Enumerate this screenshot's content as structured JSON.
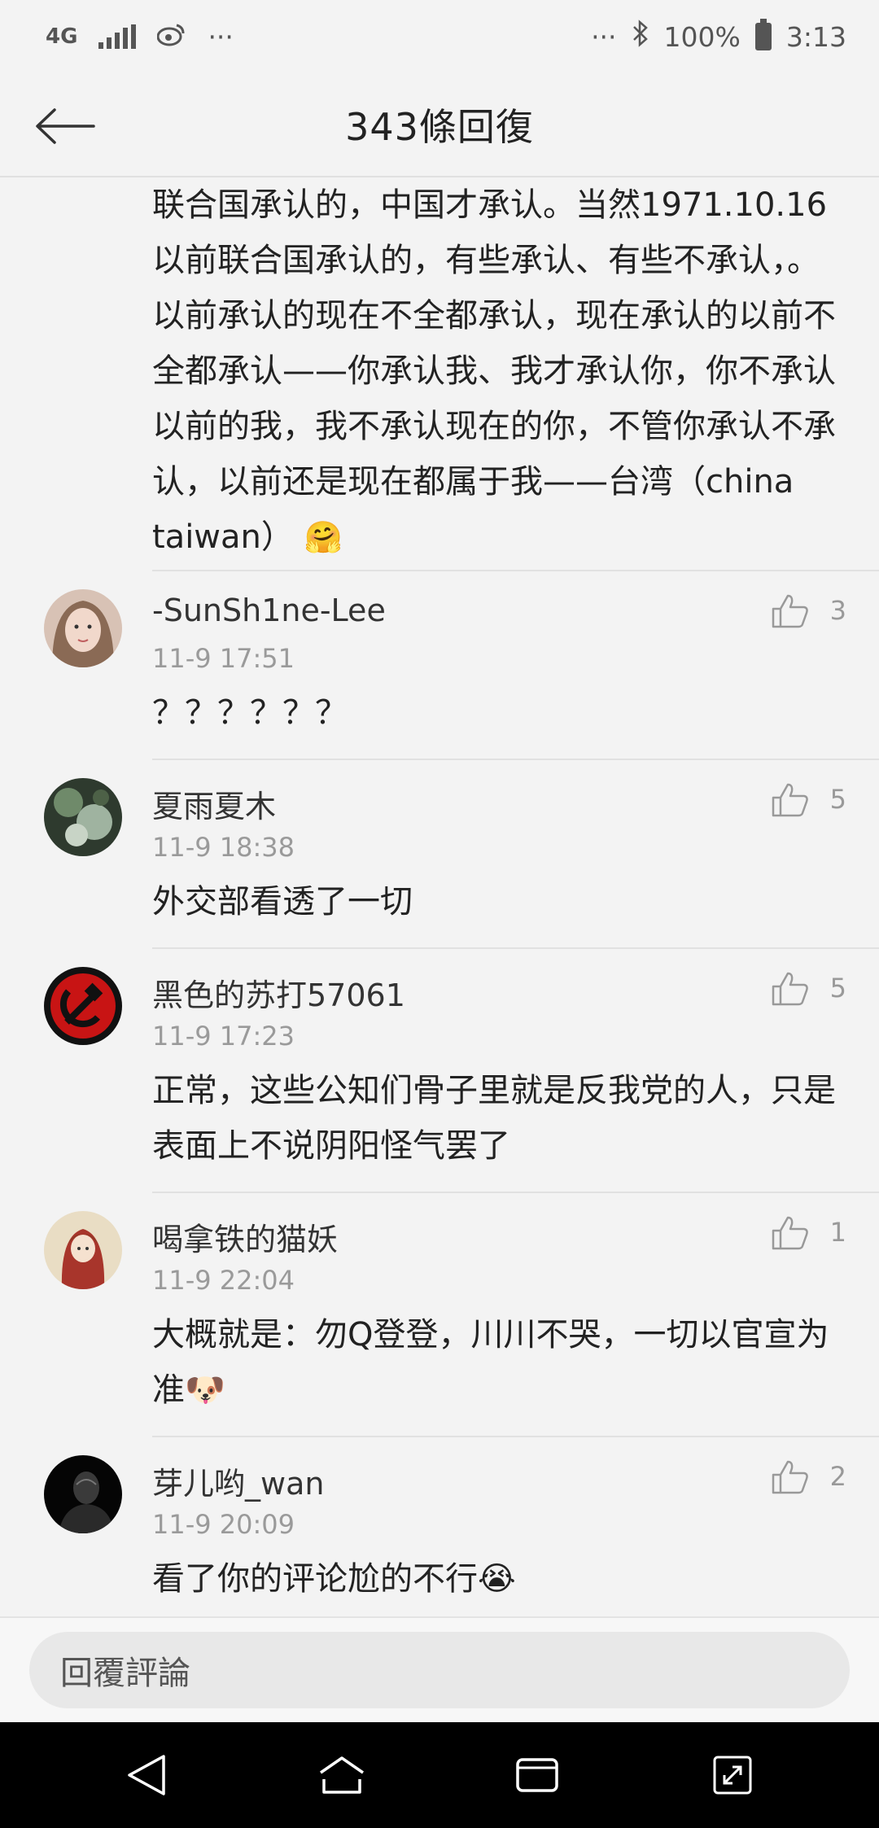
{
  "status_bar": {
    "network": "4G",
    "dots": "···",
    "dots_right": "···",
    "battery": "100%",
    "time": "3:13"
  },
  "header": {
    "title": "343條回復"
  },
  "top_comment": {
    "text": "联合国承认的，中国才承认。当然1971.10.16以前联合国承认的，有些承认、有些不承认，。以前承认的现在不全都承认，现在承认的以前不全都承认——你承认我、我才承认你，你不承认以前的我，我不承认现在的你，不管你承认不承认，以前还是现在都属于我——台湾（china taiwan）",
    "emoji": "🤗"
  },
  "comments": [
    {
      "name": "-SunSh1ne-Lee",
      "time": "11-9 17:51",
      "body": "？？？？？？",
      "likes": "3"
    },
    {
      "name": "夏雨夏木",
      "time": "11-9 18:38",
      "body": "外交部看透了一切",
      "likes": "5"
    },
    {
      "name": "黑色的苏打57061",
      "time": "11-9 17:23",
      "body": "正常，这些公知们骨子里就是反我党的人，只是表面上不说阴阳怪气罢了",
      "likes": "5"
    },
    {
      "name": "喝拿铁的猫妖",
      "time": "11-9 22:04",
      "body": "大概就是：勿Q登登，川川不哭，一切以官宣为准",
      "emoji": "🐶",
      "likes": "1"
    },
    {
      "name": "芽儿哟_wan",
      "time": "11-9 20:09",
      "body": "看了你的评论尬的不行",
      "emoji": "😭",
      "likes": "2"
    }
  ],
  "reply_bar": {
    "placeholder": "回覆評論"
  },
  "icons": {
    "back": "arrow-left-icon",
    "like": "thumbs-up-icon",
    "nav_back": "triangle-back-icon",
    "nav_home": "home-icon",
    "nav_recent": "recent-apps-icon",
    "nav_expand": "expand-icon"
  }
}
